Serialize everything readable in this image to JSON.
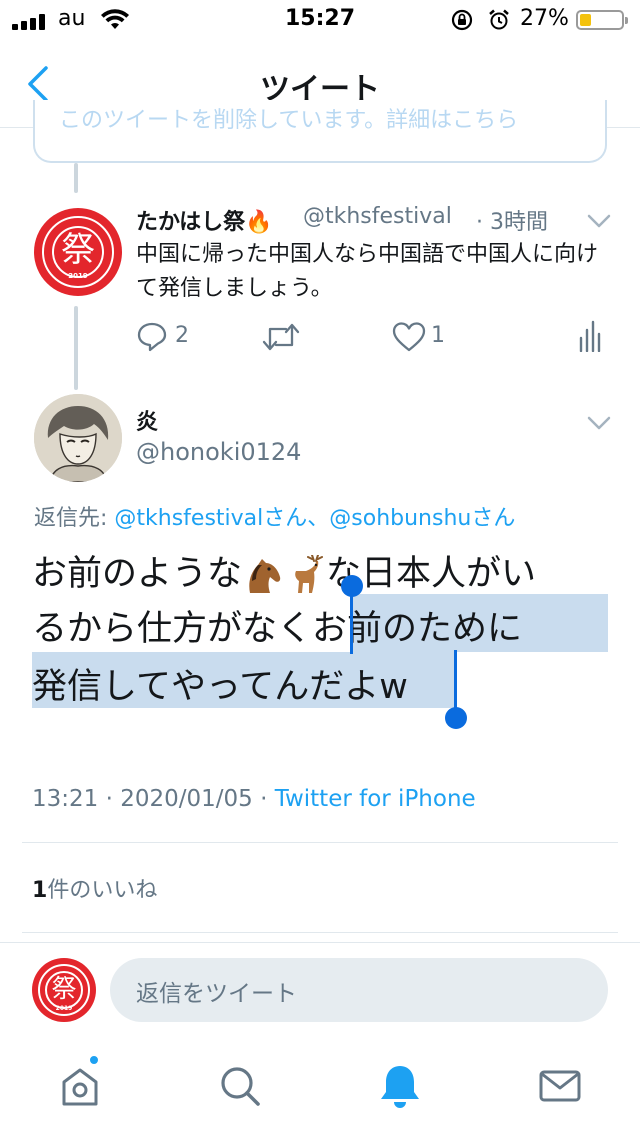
{
  "status_bar": {
    "carrier": "au",
    "time": "15:27",
    "battery_percent": "27%",
    "battery_level": 0.27,
    "icons": [
      "signal-icon",
      "wifi-icon",
      "rotation-lock-icon",
      "alarm-icon",
      "battery-icon"
    ]
  },
  "nav": {
    "title": "ツイート",
    "back_icon": "chevron-left-icon"
  },
  "quoted_card": {
    "text": "このツイートを削除しています。詳細はこちら"
  },
  "parent_tweet": {
    "display_name": "たかはし祭🔥",
    "handle": "@tkhsfestival",
    "time": "· 3時間",
    "text": "中国に帰った中国人なら中国語で中国人に向けて発信しましょう。",
    "avatar": {
      "kanji": "祭",
      "side_text": "dango",
      "year": "2019",
      "color": "#e3262c"
    },
    "reply_count": "2",
    "like_count": "1"
  },
  "tweet": {
    "display_name": "炎",
    "handle": "@honoki0124",
    "replying_label": "返信先: ",
    "replying_mentions": "@tkhsfestivalさん、@sohbunshuさん",
    "line1_a": "お前のような",
    "line1_b": "な日本人がい",
    "line2_plain": "るから仕方がなく",
    "line2_selected": "お前のために",
    "line3_selected": "発信してやってんだよw",
    "timestamp": "13:21 · 2020/01/05 · ",
    "source": "Twitter for iPhone"
  },
  "likes": {
    "count": "1",
    "label": "件のいいね"
  },
  "composer": {
    "placeholder": "返信をツイート"
  },
  "tab_bar": {
    "items": [
      "home-icon",
      "search-icon",
      "notifications-icon",
      "messages-icon"
    ],
    "active": "notifications-icon"
  },
  "colors": {
    "accent": "#1da1f2",
    "selection": "#c9dcee",
    "handle_grey": "#657786",
    "avatar_red": "#e3262c"
  }
}
